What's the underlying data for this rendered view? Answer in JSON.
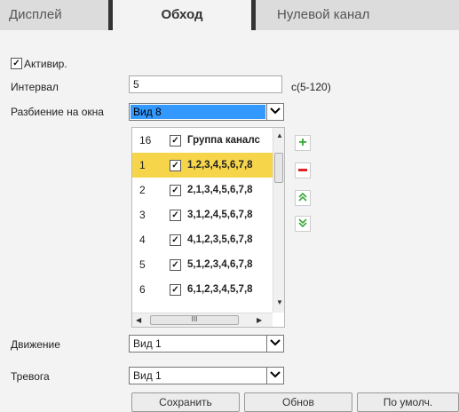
{
  "tabs": [
    {
      "label": "Дисплей"
    },
    {
      "label": "Обход"
    },
    {
      "label": "Нулевой канал"
    }
  ],
  "form": {
    "activate_label": "Активир.",
    "activate_checked": "✓",
    "interval_label": "Интервал",
    "interval_value": "5",
    "interval_hint": "с(5-120)",
    "split_label": "Разбиение на окна",
    "split_value": "Вид 8",
    "motion_label": "Движение",
    "motion_value": "Вид 1",
    "alarm_label": "Тревога",
    "alarm_value": "Вид 1"
  },
  "list": {
    "header_num": "16",
    "header_text": "Группа каналс",
    "rows": [
      {
        "num": "1",
        "channels": "1,2,3,4,5,6,7,8"
      },
      {
        "num": "2",
        "channels": "2,1,3,4,5,6,7,8"
      },
      {
        "num": "3",
        "channels": "3,1,2,4,5,6,7,8"
      },
      {
        "num": "4",
        "channels": "4,1,2,3,5,6,7,8"
      },
      {
        "num": "5",
        "channels": "5,1,2,3,4,6,7,8"
      },
      {
        "num": "6",
        "channels": "6,1,2,3,4,5,7,8"
      }
    ],
    "check_mark": "✓"
  },
  "icons": {
    "add": "+",
    "remove": "−",
    "move_up": "«",
    "move_down": "»",
    "dropdown": "⌄",
    "hthumb_grip": "III"
  },
  "colors": {
    "selected_row": "#f6d54a",
    "highlight": "#3399ff",
    "add_green": "#2eaa2e",
    "remove_red": "#dd2222",
    "move_green": "#3aa83a"
  },
  "buttons": {
    "save": "Сохранить",
    "refresh": "Обнов",
    "default": "По умолч."
  }
}
